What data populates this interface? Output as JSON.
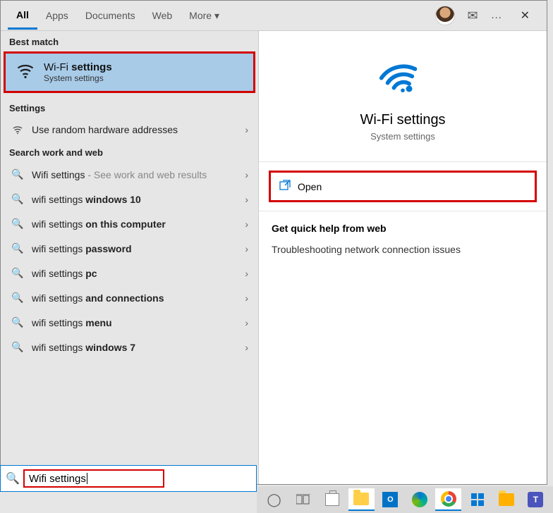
{
  "tabs": {
    "all": "All",
    "apps": "Apps",
    "documents": "Documents",
    "web": "Web",
    "more": "More"
  },
  "sections": {
    "best_match": "Best match",
    "settings": "Settings",
    "search_web": "Search work and web"
  },
  "best_match": {
    "title_pre": "Wi-Fi ",
    "title_bold": "settings",
    "subtitle": "System settings"
  },
  "settings_list": [
    {
      "label": "Use random hardware addresses"
    }
  ],
  "suggestions": [
    {
      "pre": "Wifi settings",
      "bold": "",
      "suffix": " - See work and web results"
    },
    {
      "pre": "wifi settings ",
      "bold": "windows 10",
      "suffix": ""
    },
    {
      "pre": "wifi settings ",
      "bold": "on this computer",
      "suffix": ""
    },
    {
      "pre": "wifi settings ",
      "bold": "password",
      "suffix": ""
    },
    {
      "pre": "wifi settings ",
      "bold": "pc",
      "suffix": ""
    },
    {
      "pre": "wifi settings ",
      "bold": "and connections",
      "suffix": ""
    },
    {
      "pre": "wifi settings ",
      "bold": "menu",
      "suffix": ""
    },
    {
      "pre": "wifi settings ",
      "bold": "windows 7",
      "suffix": ""
    }
  ],
  "detail": {
    "title": "Wi-Fi settings",
    "subtitle": "System settings",
    "open": "Open",
    "help_header": "Get quick help from web",
    "help_items": [
      "Troubleshooting network connection issues"
    ]
  },
  "search": {
    "query": "Wifi settings"
  },
  "colors": {
    "accent": "#0078d4",
    "highlight_border": "#d40000",
    "selected_bg": "#a8cbe8"
  }
}
